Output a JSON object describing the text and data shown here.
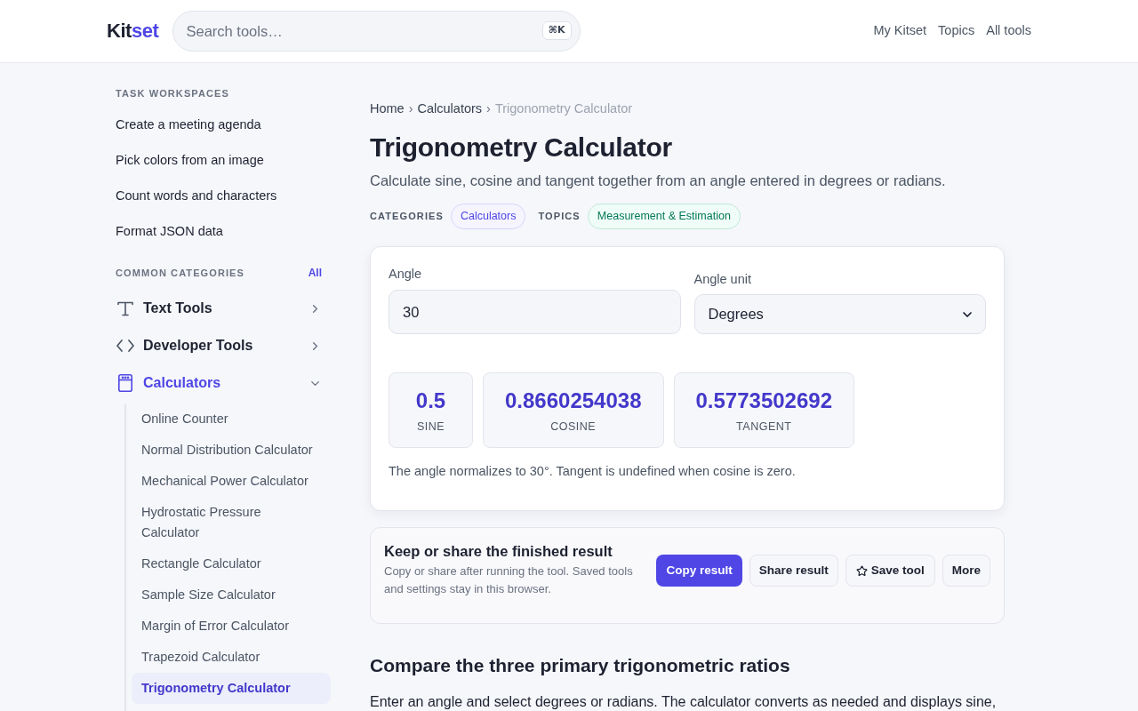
{
  "header": {
    "logo": {
      "text": "Kit",
      "accent": "set"
    },
    "search": {
      "placeholder": "Search tools…",
      "shortcut": "⌘K"
    },
    "nav": [
      "My Kitset",
      "Topics",
      "All tools"
    ]
  },
  "sidebar": {
    "workspaces": {
      "heading": "TASK WORKSPACES",
      "items": [
        "Create a meeting agenda",
        "Pick colors from an image",
        "Count words and characters",
        "Format JSON data"
      ]
    },
    "categories": {
      "heading": "COMMON CATEGORIES",
      "all_link": "All",
      "items": [
        {
          "label": "Text Tools",
          "kind": "text",
          "selected": false,
          "expanded": false
        },
        {
          "label": "Developer Tools",
          "kind": "code",
          "selected": false,
          "expanded": false
        },
        {
          "label": "Calculators",
          "kind": "calculator",
          "selected": true,
          "expanded": true,
          "children": [
            {
              "label": "Online Counter",
              "selected": false
            },
            {
              "label": "Normal Distribution Calculator",
              "selected": false
            },
            {
              "label": "Mechanical Power Calculator",
              "selected": false
            },
            {
              "label": "Hydrostatic Pressure Calculator",
              "selected": false
            },
            {
              "label": "Rectangle Calculator",
              "selected": false
            },
            {
              "label": "Sample Size Calculator",
              "selected": false
            },
            {
              "label": "Margin of Error Calculator",
              "selected": false
            },
            {
              "label": "Trapezoid Calculator",
              "selected": false
            },
            {
              "label": "Trigonometry Calculator",
              "selected": true
            }
          ]
        }
      ]
    }
  },
  "main": {
    "breadcrumb": {
      "separator": "›",
      "items": [
        "Home",
        "Calculators",
        "Trigonometry Calculator"
      ]
    },
    "title": "Trigonometry Calculator",
    "description": "Calculate sine, cosine and tangent together from an angle entered in degrees or radians.",
    "taxonomy": [
      {
        "label": "CATEGORIES",
        "kind": "category",
        "tags": [
          "Calculators"
        ]
      },
      {
        "label": "TOPICS",
        "kind": "topic",
        "tags": [
          "Measurement & Estimation"
        ]
      }
    ],
    "calculator": {
      "fields": [
        {
          "kind": "number",
          "label": "Angle",
          "value": "30"
        },
        {
          "kind": "select",
          "label": "Angle unit",
          "value": "Degrees"
        }
      ],
      "results": [
        {
          "value": "0.5",
          "label": "SINE"
        },
        {
          "value": "0.8660254038",
          "label": "COSINE"
        },
        {
          "value": "0.5773502692",
          "label": "TANGENT"
        }
      ],
      "note": "The angle normalizes to 30°. Tangent is undefined when cosine is zero."
    },
    "share": {
      "title": "Keep or share the finished result",
      "description": "Copy or share after running the tool. Saved tools and settings stay in this browser.",
      "buttons": [
        {
          "label": "Copy result",
          "kind": "primary"
        },
        {
          "label": "Share result",
          "kind": "secondary"
        },
        {
          "label": "Save tool",
          "kind": "favorite"
        },
        {
          "label": "More",
          "kind": "secondary"
        }
      ]
    },
    "article": {
      "heading": "Compare the three primary trigonometric ratios",
      "paragraph": "Enter an angle and select degrees or radians. The calculator converts as needed and displays sine,"
    }
  }
}
